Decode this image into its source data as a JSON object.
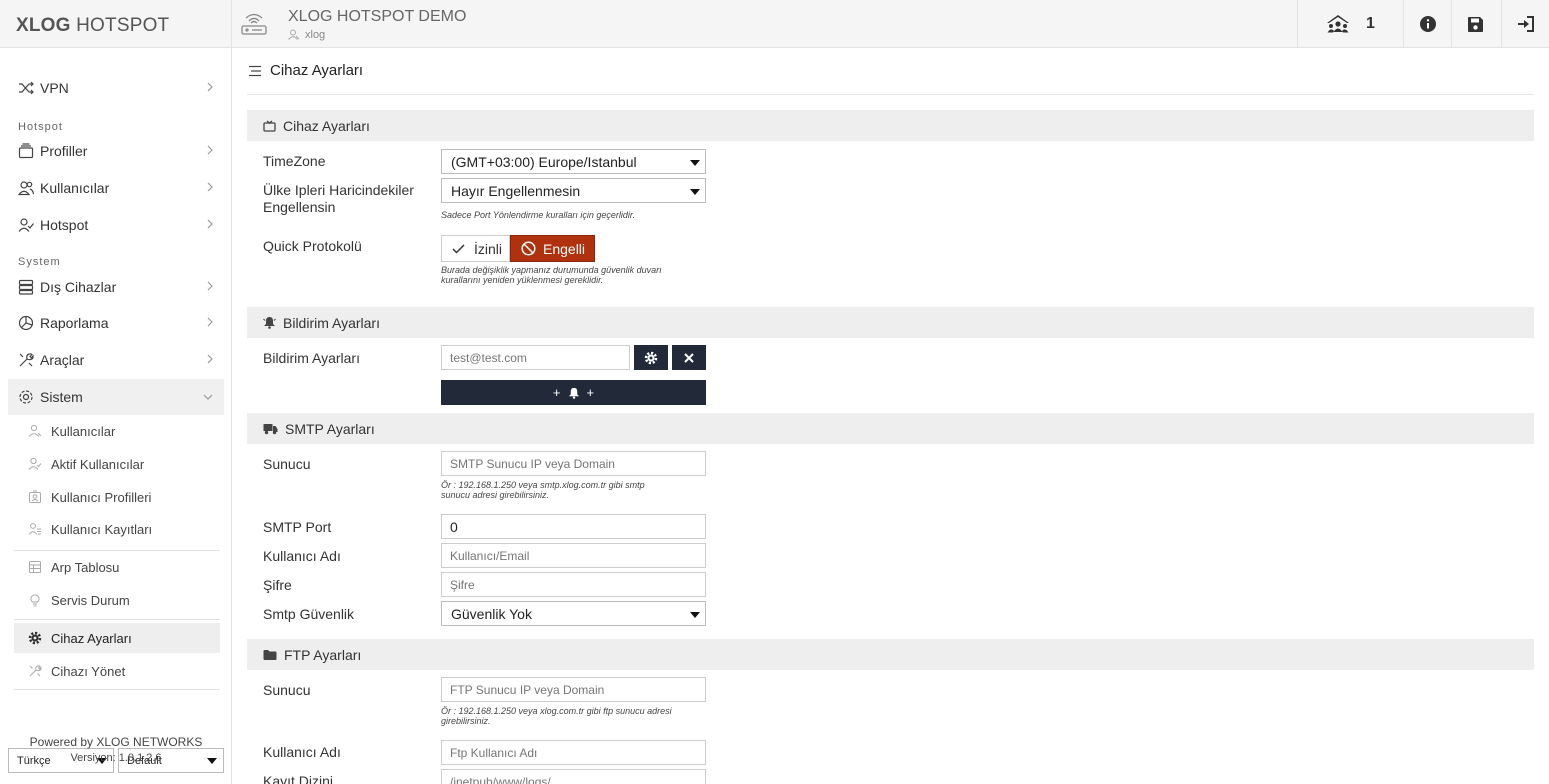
{
  "header": {
    "brand_bold": "XLOG",
    "brand_light": " HOTSPOT",
    "title": "XLOG HOTSPOT DEMO",
    "user": "xlog",
    "online_count": "1"
  },
  "sidebar": {
    "vpn": "VPN",
    "section_hotspot": "Hotspot",
    "profiller": "Profiller",
    "kullanicilar": "Kullanıcılar",
    "hotspot": "Hotspot",
    "section_system": "System",
    "dis_cihazlar": "Dış Cihazlar",
    "raporlama": "Raporlama",
    "araclar": "Araçlar",
    "sistem": "Sistem",
    "sub": {
      "kullanicilar": "Kullanıcılar",
      "aktif": "Aktif Kullanıcılar",
      "profiller": "Kullanıcı Profilleri",
      "kayitlar": "Kullanıcı Kayıtları",
      "arp": "Arp Tablosu",
      "servis": "Servis Durum",
      "cihaz_ayarlari": "Cihaz Ayarları",
      "cihazi_yonet": "Cihazı Yönet"
    },
    "language": "Türkçe",
    "theme": "Default",
    "powered": "Powered by XLOG NETWORKS",
    "version": "Versiyon: 1.0.1.2.6"
  },
  "main": {
    "page_title": "Cihaz Ayarları",
    "device": {
      "section": "Cihaz Ayarları",
      "timezone_label": "TimeZone",
      "timezone_value": "(GMT+03:00) Europe/Istanbul",
      "country_label_1": "Ülke Ipleri Haricindekiler",
      "country_label_2": "Engellensin",
      "country_value": "Hayır Engellenmesin",
      "country_help": "Sadece Port Yönlendirme kuralları için geçerlidir.",
      "quick_label": "Quick Protokolü",
      "allow_label": "İzinli",
      "block_label": "Engelli",
      "quick_help_1": "Burada değişiklik yapmanız durumunda güvenlik duvarı",
      "quick_help_2": "kurallarını yeniden yüklenmesi gereklidir."
    },
    "notify": {
      "section": "Bildirim Ayarları",
      "label": "Bildirim Ayarları",
      "placeholder": "test@test.com"
    },
    "smtp": {
      "section": "SMTP Ayarları",
      "server_label": "Sunucu",
      "server_placeholder": "SMTP Sunucu IP veya Domain",
      "server_help_1": "Ör : 192.168.1.250 veya smtp.xlog.com.tr gibi smtp",
      "server_help_2": "sunucu adresi girebilirsiniz.",
      "port_label": "SMTP Port",
      "port_value": "0",
      "user_label": "Kullanıcı Adı",
      "user_placeholder": "Kullanıcı/Email",
      "pass_label": "Şifre",
      "pass_placeholder": "Şifre",
      "security_label": "Smtp Güvenlik",
      "security_value": "Güvenlik Yok"
    },
    "ftp": {
      "section": "FTP Ayarları",
      "server_label": "Sunucu",
      "server_placeholder": "FTP Sunucu IP veya Domain",
      "server_help_1": "Ör : 192.168.1.250 veya xlog.com.tr gibi ftp sunucu adresi",
      "server_help_2": "girebilirsiniz.",
      "user_label": "Kullanıcı Adı",
      "user_placeholder": "Ftp Kullanıcı Adı",
      "dir_label": "Kayıt Dizini",
      "dir_placeholder": "/inetpub/www/logs/"
    }
  },
  "colors": {
    "danger": "#b0310d",
    "dark_button": "#222a3a",
    "section_bg": "#eeeeee"
  },
  "icons": [
    "router-icon",
    "user-icon",
    "users-online-icon",
    "info-icon",
    "save-icon",
    "logout-icon",
    "shuffle-icon",
    "layers-icon",
    "users-icon",
    "user-check-icon",
    "server-icon",
    "chart-icon",
    "tools-icon",
    "gear-icon",
    "menu-icon",
    "tv-icon",
    "bell-icon",
    "truck-icon",
    "folder-icon",
    "check-icon",
    "ban-icon",
    "close-icon"
  ]
}
